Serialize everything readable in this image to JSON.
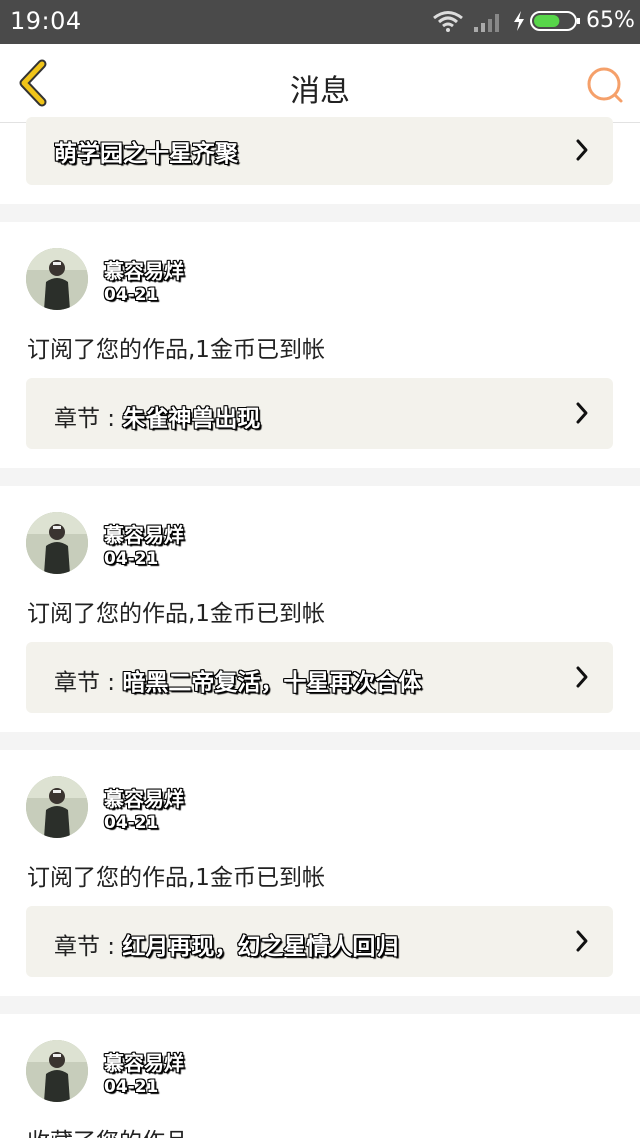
{
  "status_bar": {
    "time": "19:04",
    "battery_pct": "65%",
    "battery_level": 0.65
  },
  "header": {
    "title": "消息"
  },
  "top_banner": {
    "text": "萌学园之十星齐聚"
  },
  "messages": [
    {
      "user": "慕容易烊",
      "date": "04-21",
      "text": "订阅了您的作品,1金币已到帐",
      "chapter_prefix": "章节 : ",
      "chapter": "朱雀神兽出现"
    },
    {
      "user": "慕容易烊",
      "date": "04-21",
      "text": "订阅了您的作品,1金币已到帐",
      "chapter_prefix": "章节 : ",
      "chapter": "暗黑二帝复活，十星再次合体"
    },
    {
      "user": "慕容易烊",
      "date": "04-21",
      "text": "订阅了您的作品,1金币已到帐",
      "chapter_prefix": "章节 : ",
      "chapter": "红月再现，幻之星情人回归"
    },
    {
      "user": "慕容易烊",
      "date": "04-21",
      "text": "收藏了您的作品"
    }
  ],
  "colors": {
    "back_arrow": "#f0c419",
    "search_icon": "#f5a06a",
    "status_bar": "#4a4a4a",
    "battery": "#58d64a"
  }
}
